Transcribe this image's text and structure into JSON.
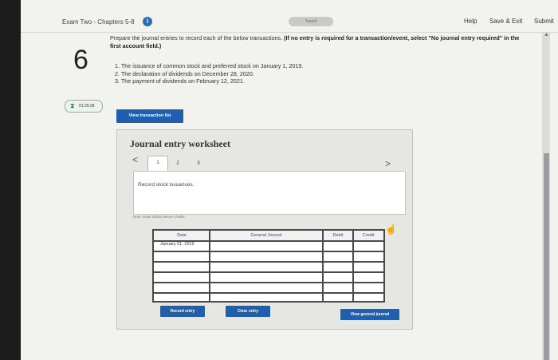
{
  "header": {
    "exam_title": "Exam Two - Chapters 5-8",
    "saved": "Saved",
    "help": "Help",
    "save_exit": "Save & Exit",
    "submit": "Submit"
  },
  "question": {
    "number": "6",
    "instruction_plain": "Prepare the journal entries to record each of the below transactions.",
    "instruction_bold": "(If no entry is required for a transaction/event, select \"No journal entry required\" in the first account field.)",
    "steps": [
      "1. The issuance of common stock and preferred stock on January 1, 2019.",
      "2. The declaration of dividends on December 28, 2020.",
      "3. The payment of dividends on February 12, 2021."
    ]
  },
  "timer": {
    "time": "01:29:28"
  },
  "view_transaction_list": "View transaction list",
  "worksheet": {
    "title": "Journal entry worksheet",
    "tabs": [
      "1",
      "2",
      "3"
    ],
    "prev": "<",
    "next": ">",
    "record_text": "Record stock issuances.",
    "note": "Note: Enter debits before credits.",
    "columns": [
      "Date",
      "General Journal",
      "Debit",
      "Credit"
    ],
    "first_date": "January 01, 2019",
    "record_entry": "Record entry",
    "clear_entry": "Clear entry",
    "view_general_journal": "View general journal"
  }
}
